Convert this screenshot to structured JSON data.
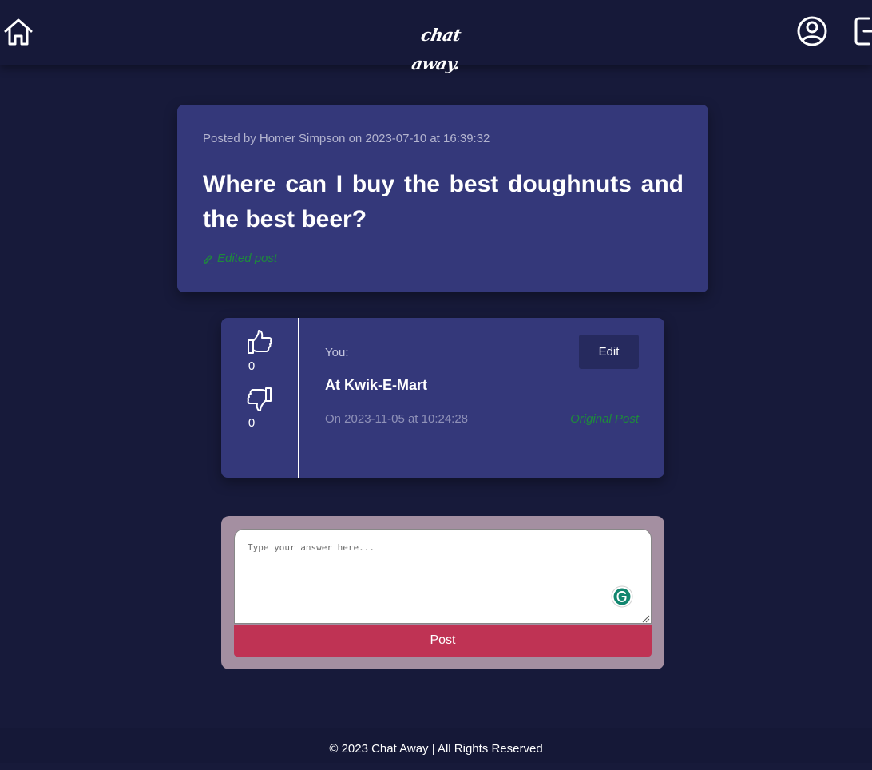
{
  "header": {
    "logo_text": "chat away.",
    "icons": [
      "home-icon",
      "user-circle-icon",
      "logout-icon"
    ]
  },
  "post": {
    "meta": "Posted by Homer Simpson on 2023-07-10 at 16:39:32",
    "title": "Where can I buy the best doughnuts and the best beer?",
    "edited_label": "Edited post"
  },
  "answer": {
    "likes": "0",
    "dislikes": "0",
    "author": "You:",
    "edit_label": "Edit",
    "text": "At Kwik-E-Mart",
    "date": "On 2023-11-05 at 10:24:28",
    "original_post_label": "Original Post"
  },
  "reply": {
    "placeholder": "Type your answer here...",
    "post_label": "Post"
  },
  "footer": {
    "text": "© 2023 Chat Away | All Rights Reserved"
  },
  "colors": {
    "background": "#171a3a",
    "card": "#34387a",
    "accent_green": "#1e8a3c",
    "post_button": "#bf3354",
    "reply_box": "#a48fa1"
  }
}
